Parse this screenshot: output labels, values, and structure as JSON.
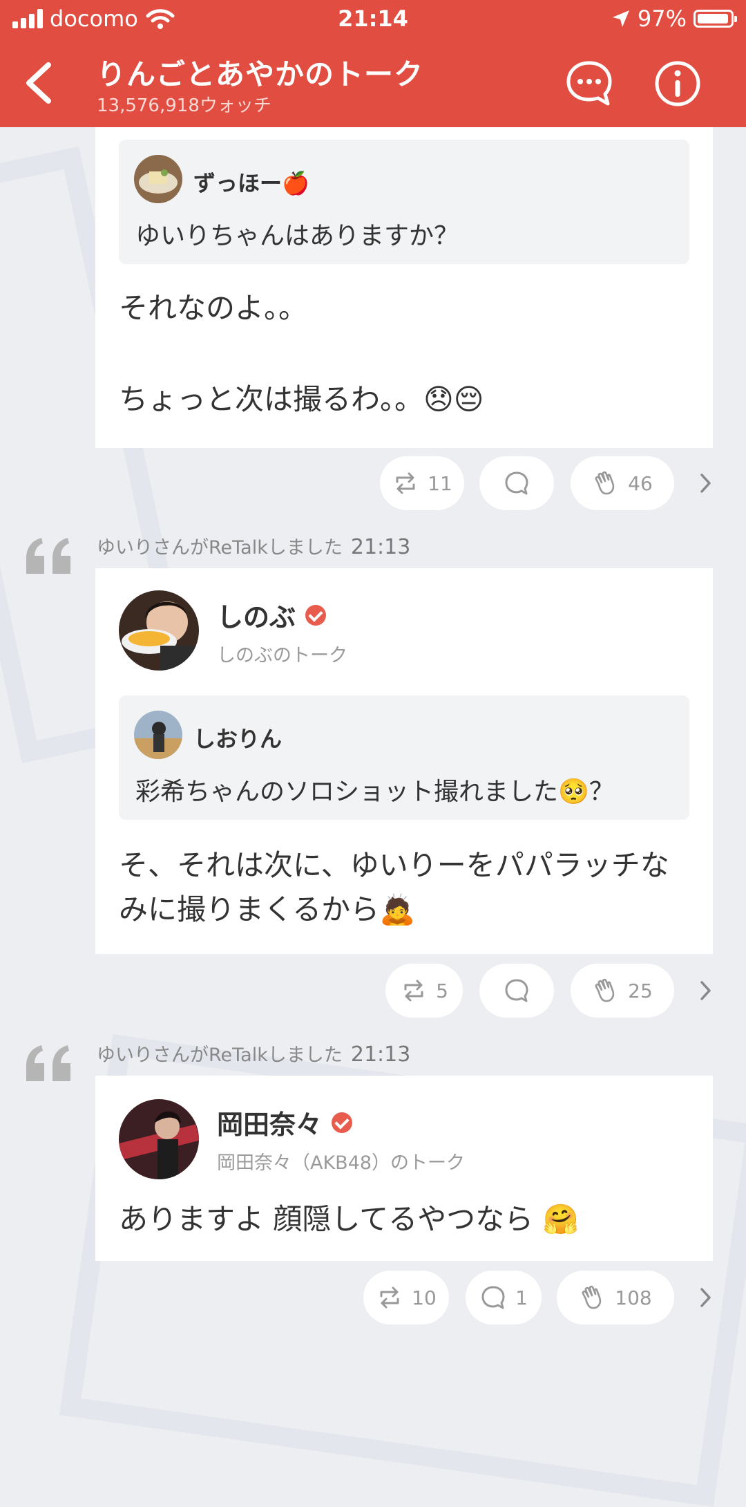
{
  "status_bar": {
    "carrier": "docomo",
    "time": "21:14",
    "battery": "97%",
    "battery_level": 0.97
  },
  "header": {
    "title": "りんごとあやかのトーク",
    "subtitle": "13,576,918ウォッチ",
    "icons": [
      "back-chevron-icon",
      "chat-bubble-icon",
      "info-icon"
    ]
  },
  "posts": [
    {
      "quote": {
        "name": "ずっほー🍎",
        "text": "ゆいりちゃんはありますか？"
      },
      "message_line1": "それなのよ。。",
      "message_line2": "ちょっと次は撮るわ。。😞😔",
      "actions": {
        "retalk_count": "11",
        "comment_count": "",
        "clap_count": "46"
      }
    },
    {
      "retalk_label": "ゆいりさんがReTalkしました",
      "retalk_time": "21:13",
      "author": "しのぶ",
      "talk_name": "しのぶのトーク",
      "quote": {
        "name": "しおりん",
        "text": "彩希ちゃんのソロショット撮れました🥺？"
      },
      "message": "そ、それは次に、ゆいりーをパパラッチなみに撮りまくるから🙇",
      "actions": {
        "retalk_count": "5",
        "comment_count": "",
        "clap_count": "25"
      }
    },
    {
      "retalk_label": "ゆいりさんがReTalkしました",
      "retalk_time": "21:13",
      "author": "岡田奈々",
      "talk_name": "岡田奈々（AKB48）のトーク",
      "message": "ありますよ 顔隠してるやつなら 🤗",
      "actions": {
        "retalk_count": "10",
        "comment_count": "1",
        "clap_count": "108"
      }
    }
  ],
  "colors": {
    "brand": "#e14d40",
    "verified": "#e85c4e"
  }
}
